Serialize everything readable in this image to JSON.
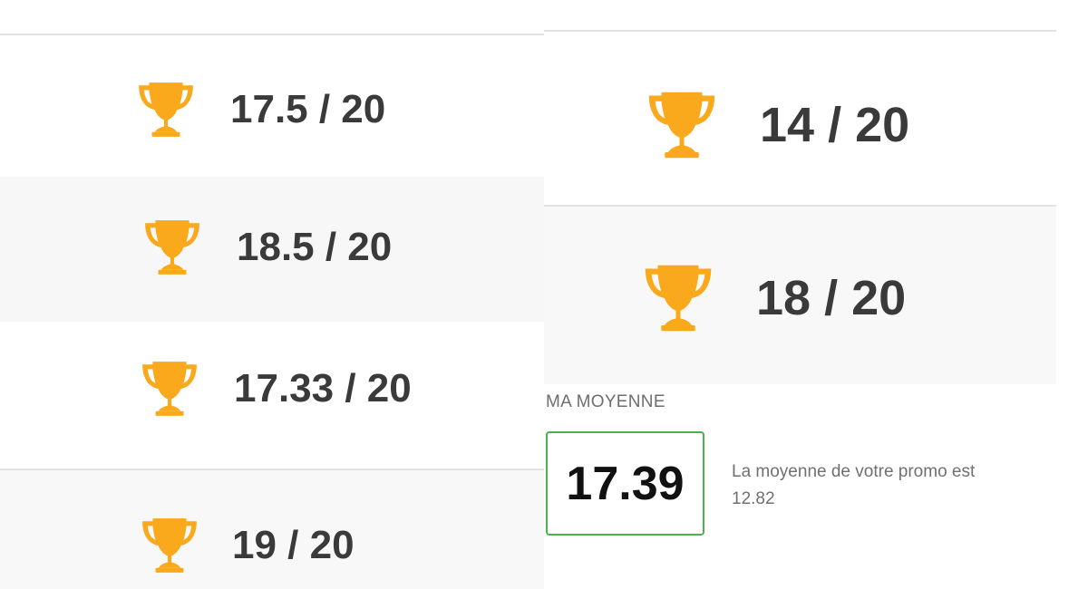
{
  "grades_left": [
    {
      "score": "17.5 / 20",
      "icon": "trophy-icon"
    },
    {
      "score": "18.5 / 20",
      "icon": "trophy-icon"
    },
    {
      "score": "17.33 / 20",
      "icon": "trophy-icon"
    },
    {
      "score": "19 / 20",
      "icon": "trophy-icon"
    }
  ],
  "grades_right": [
    {
      "score": "14 / 20",
      "icon": "trophy-icon"
    },
    {
      "score": "18 / 20",
      "icon": "trophy-icon"
    }
  ],
  "average": {
    "label": "MA MOYENNE",
    "value": "17.39",
    "promo_text": "La moyenne de votre promo est",
    "promo_value": "12.82"
  },
  "colors": {
    "trophy": "#F9A91B",
    "average_border": "#4CAF50",
    "grade_text": "#3A3A3A"
  }
}
